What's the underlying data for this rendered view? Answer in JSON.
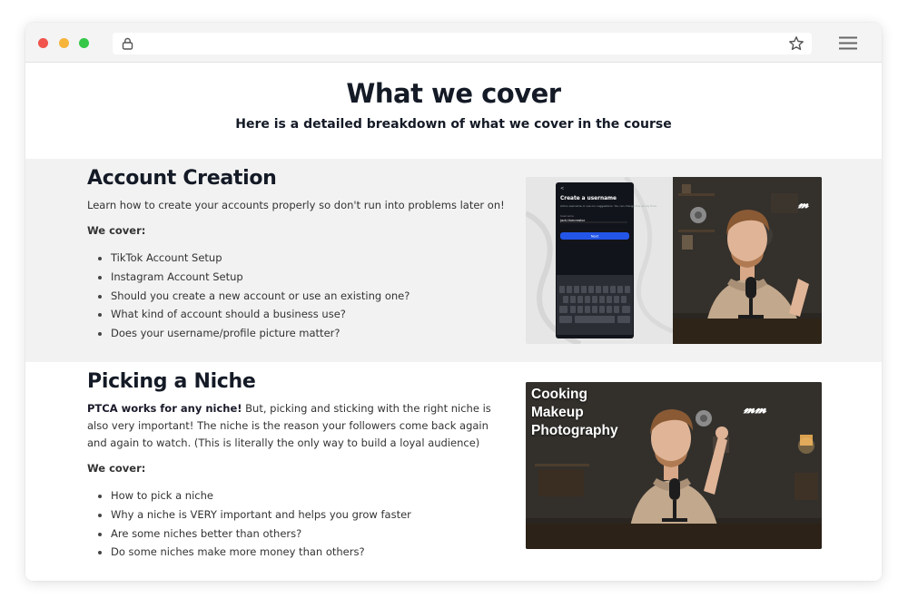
{
  "hero": {
    "title": "What we cover",
    "subtitle": "Here is a detailed breakdown of what we cover in the course"
  },
  "sections": [
    {
      "title": "Account Creation",
      "description": "Learn how to create your accounts properly so don't run into problems later on!",
      "cover_label": "We cover:",
      "items": [
        "TikTok Account Setup",
        "Instagram Account Setup",
        "Should you create a new account or use an existing one?",
        "What kind of account should a business use?",
        "Does your username/profile picture matter?"
      ],
      "phone": {
        "heading": "Create a username",
        "hint": "Add a username or use our suggestions. You can change this at any time.",
        "input_label": "Username",
        "input_value": "jack.thecreator",
        "button": "Next"
      }
    },
    {
      "title": "Picking a Niche",
      "description_bold": "PTCA works for any niche!",
      "description_rest": " But, picking and sticking with the right niche is also very important! The niche is the reason your followers come back again and again to watch. (This is literally the only way to build a loyal audience)",
      "cover_label": "We cover:",
      "items": [
        "How to pick a niche",
        "Why a niche is VERY important and helps you grow faster",
        "Are some niches better than others?",
        "Do some niches make more money than others?"
      ],
      "overlay": [
        "Cooking",
        "Makeup",
        "Photography"
      ]
    }
  ],
  "colors": {
    "section_alt_bg": "#f2f2f2",
    "heading": "#141a26",
    "phone_button": "#2356e8"
  }
}
